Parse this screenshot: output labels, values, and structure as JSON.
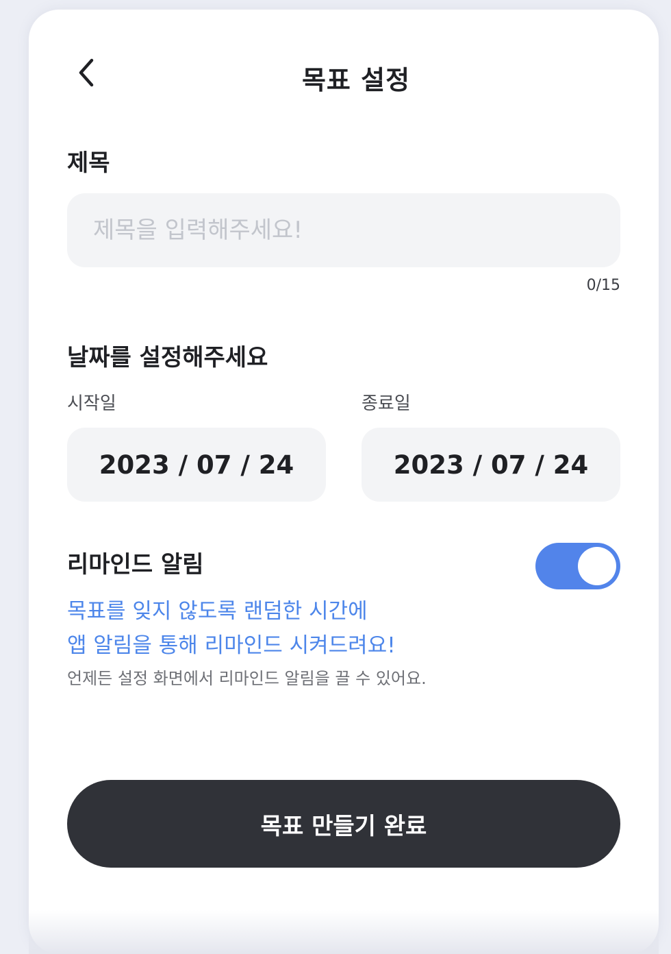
{
  "header": {
    "title": "목표 설정",
    "back_icon": "chevron-left-icon"
  },
  "title_section": {
    "label": "제목",
    "input_value": "",
    "placeholder": "제목을 입력해주세요!",
    "char_count": "0/15"
  },
  "date_section": {
    "label": "날짜를 설정해주세요",
    "start_label": "시작일",
    "start_value": "2023 / 07 / 24",
    "end_label": "종료일",
    "end_value": "2023 / 07 / 24"
  },
  "reminder": {
    "label": "리마인드 알림",
    "enabled": true,
    "description_line1": "목표를 잊지 않도록 랜덤한 시간에",
    "description_line2": "앱 알림을 통해 리마인드 시켜드려요!",
    "note": "언제든 설정 화면에서 리마인드 알림을 끌 수 있어요."
  },
  "submit": {
    "label": "목표 만들기 완료"
  },
  "colors": {
    "accent": "#5284ea",
    "button_dark": "#303238",
    "field_bg": "#f3f4f6",
    "reminder_text": "#4d86ea"
  }
}
